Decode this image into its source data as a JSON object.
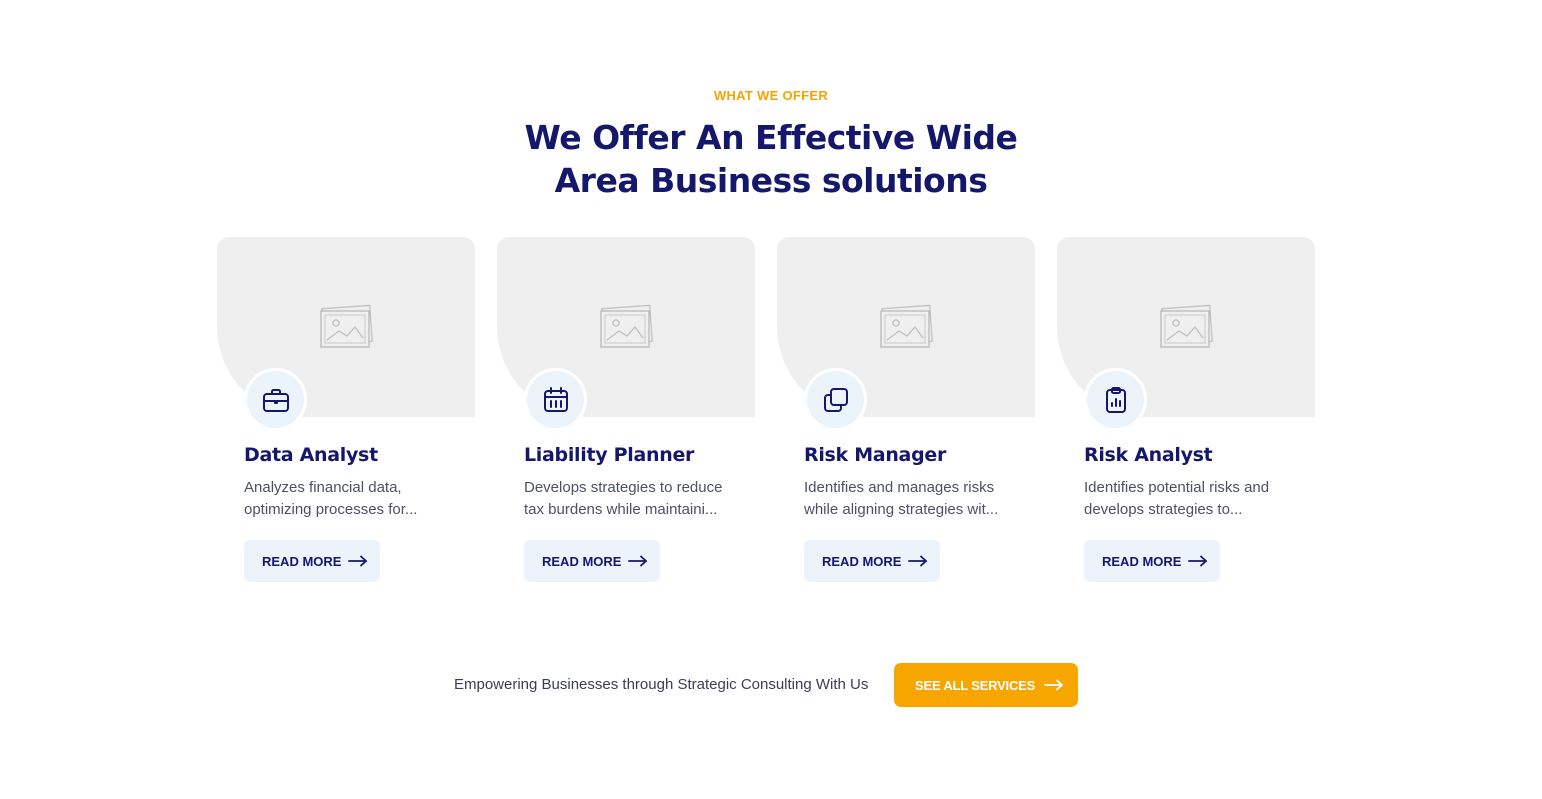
{
  "section": {
    "eyebrow": "WHAT WE OFFER",
    "headline_line1": "We Offer An Effective Wide",
    "headline_line2": "Area Business solutions"
  },
  "cards": [
    {
      "title": "Data Analyst",
      "desc_line1": "Analyzes financial data,",
      "desc_line2": "optimizing processes for...",
      "button": "READ MORE",
      "icon": "briefcase-icon"
    },
    {
      "title": "Liability Planner",
      "desc_line1": "Develops strategies to reduce",
      "desc_line2": "tax burdens while maintaini...",
      "button": "READ MORE",
      "icon": "calendar-icon"
    },
    {
      "title": "Risk Manager",
      "desc_line1": "Identifies and manages risks",
      "desc_line2": "while aligning strategies wit...",
      "button": "READ MORE",
      "icon": "copy-icon"
    },
    {
      "title": "Risk Analyst",
      "desc_line1": "Identifies potential risks and",
      "desc_line2": "develops strategies to...",
      "button": "READ MORE",
      "icon": "clipboard-chart-icon"
    }
  ],
  "footer": {
    "text": "Empowering Businesses through Strategic Consulting With Us",
    "cta": "SEE ALL SERVICES"
  },
  "colors": {
    "accent": "#f5a300",
    "navy": "#15186a",
    "badge_bg": "#ebf3fb",
    "placeholder_bg": "#efefef"
  }
}
